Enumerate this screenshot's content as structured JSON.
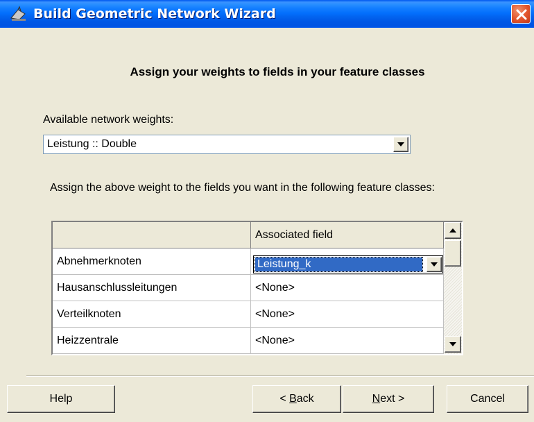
{
  "window": {
    "title": "Build Geometric Network Wizard",
    "app_icon": "network-wizard-icon",
    "close_icon": "close-icon"
  },
  "page": {
    "heading": "Assign your weights to fields in your feature classes",
    "weights_label": "Available network weights:",
    "weights_selected": "Leistung :: Double",
    "description": "Assign the above weight to the fields you want in the following feature classes:"
  },
  "grid": {
    "header": [
      "",
      "Associated field"
    ],
    "rows": [
      {
        "feature_class": "Abnehmerknoten",
        "field": "Leistung_k"
      },
      {
        "feature_class": "Hausanschlussleitungen",
        "field": "<None>"
      },
      {
        "feature_class": "Verteilknoten",
        "field": "<None>"
      },
      {
        "feature_class": "Heizzentrale",
        "field": "<None>"
      }
    ],
    "editing_row": 0
  },
  "buttons": {
    "help": "Help",
    "back_mnemonic": "B",
    "back_rest": "ack",
    "back_prefix": "< ",
    "next_mnemonic": "N",
    "next_rest": "ext >",
    "cancel": "Cancel"
  },
  "colors": {
    "title_bar": "#0054e3",
    "selection": "#316ac5",
    "dialog_bg": "#ece9d8",
    "close_button": "#e2542a"
  }
}
